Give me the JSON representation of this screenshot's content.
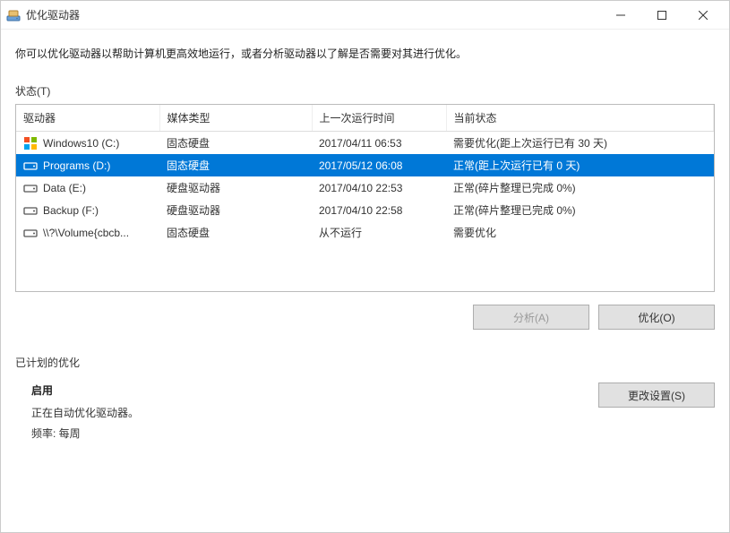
{
  "window": {
    "title": "优化驱动器"
  },
  "description": "你可以优化驱动器以帮助计算机更高效地运行，或者分析驱动器以了解是否需要对其进行优化。",
  "statusLabel": "状态(T)",
  "table": {
    "headers": {
      "drive": "驱动器",
      "media": "媒体类型",
      "lastrun": "上一次运行时间",
      "status": "当前状态"
    },
    "rows": [
      {
        "icon": "windows",
        "drive": "Windows10 (C:)",
        "media": "固态硬盘",
        "lastrun": "2017/04/11 06:53",
        "status": "需要优化(距上次运行已有 30 天)",
        "selected": false
      },
      {
        "icon": "hdd",
        "drive": "Programs (D:)",
        "media": "固态硬盘",
        "lastrun": "2017/05/12 06:08",
        "status": "正常(距上次运行已有 0 天)",
        "selected": true
      },
      {
        "icon": "hdd",
        "drive": "Data (E:)",
        "media": "硬盘驱动器",
        "lastrun": "2017/04/10 22:53",
        "status": "正常(碎片整理已完成 0%)",
        "selected": false
      },
      {
        "icon": "hdd",
        "drive": "Backup (F:)",
        "media": "硬盘驱动器",
        "lastrun": "2017/04/10 22:58",
        "status": "正常(碎片整理已完成 0%)",
        "selected": false
      },
      {
        "icon": "hdd",
        "drive": "\\\\?\\Volume{cbcb...",
        "media": "固态硬盘",
        "lastrun": "从不运行",
        "status": "需要优化",
        "selected": false
      }
    ]
  },
  "buttons": {
    "analyze": "分析(A)",
    "optimize": "优化(O)",
    "changeSettings": "更改设置(S)"
  },
  "schedule": {
    "title": "已计划的优化",
    "enabled": "启用",
    "line1": "正在自动优化驱动器。",
    "line2": "频率: 每周"
  }
}
